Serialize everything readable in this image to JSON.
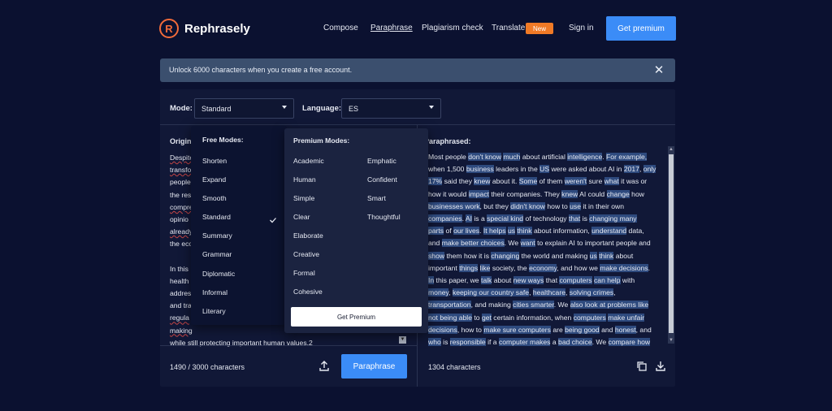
{
  "header": {
    "logo_mark": "R",
    "brand": "Rephrasely",
    "nav": [
      "Compose",
      "Paraphrase",
      "Plagiarism check",
      "Translate"
    ],
    "new_badge": "New",
    "sign_in": "Sign in",
    "get_premium": "Get premium"
  },
  "banner": {
    "text": "Unlock 6000 characters when you create a free account.",
    "close": "✕"
  },
  "controls": {
    "mode_label": "Mode:",
    "mode_value": "Standard",
    "language_label": "Language:",
    "language_value": "ES"
  },
  "dropdown": {
    "free_title": "Free Modes:",
    "free_modes": [
      "Shorten",
      "Expand",
      "Smooth",
      "Standard",
      "Summary",
      "Grammar",
      "Diplomatic",
      "Informal",
      "Literary"
    ],
    "selected": "Standard",
    "premium_title": "Premium Modes:",
    "premium_col1": [
      "Academic",
      "Human",
      "Simple",
      "Clear",
      "Elaborate",
      "Creative",
      "Formal",
      "Cohesive"
    ],
    "premium_col2": [
      "Emphatic",
      "Confident",
      "Smart",
      "Thoughtful"
    ],
    "get_premium_button": "Get Premium"
  },
  "original": {
    "title": "Original:",
    "lines_p1": [
      "Despite",
      "transfo",
      "people",
      "the res",
      "compre",
      "opinio",
      "already",
      "the eco"
    ],
    "lines_p2": [
      "In this",
      "health",
      "addres",
      "and tra",
      "regula",
      "making",
      "while still protecting important human values.2"
    ],
    "char_count": "1490 / 3000 characters",
    "paraphrase_button": "Paraphrase"
  },
  "paraphrased": {
    "title": "Paraphrased:",
    "char_count": "1304 characters"
  },
  "colors": {
    "background": "#0b1130",
    "panel": "#111837",
    "accent": "#3b8cf7",
    "brand_orange": "#f26b3a",
    "highlight": "#2e4a7e"
  }
}
